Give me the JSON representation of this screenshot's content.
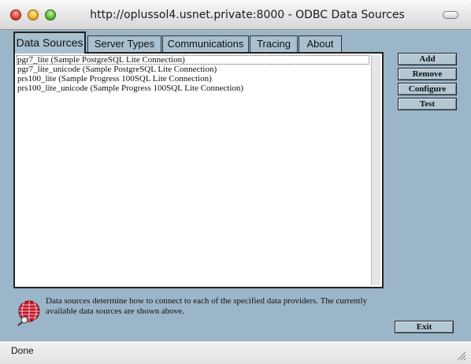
{
  "window": {
    "title": "http://oplussol4.usnet.private:8000 - ODBC Data Sources"
  },
  "tabs": [
    {
      "label": "Data Sources",
      "active": true
    },
    {
      "label": "Server Types",
      "active": false
    },
    {
      "label": "Communications",
      "active": false
    },
    {
      "label": "Tracing",
      "active": false
    },
    {
      "label": "About",
      "active": false
    }
  ],
  "data_sources": [
    "pgr7_lite (Sample PostgreSQL Lite Connection)",
    "pgr7_lite_unicode (Sample PostgreSQL Lite Connection)",
    "prs100_lite (Sample Progress 100SQL Lite Connection)",
    "prs100_lite_unicode (Sample Progress 100SQL Lite Connection)"
  ],
  "buttons": {
    "add": "Add",
    "remove": "Remove",
    "configure": "Configure",
    "test": "Test",
    "exit": "Exit"
  },
  "info": {
    "text": "Data sources determine how to connect to each of the specified data providers. The currently available data sources are shown above.",
    "icon": "data-sources-globe-icon"
  },
  "status": {
    "text": "Done"
  },
  "colors": {
    "window_bg": "#9bb6c8",
    "button_bg": "#b4c8d4"
  }
}
